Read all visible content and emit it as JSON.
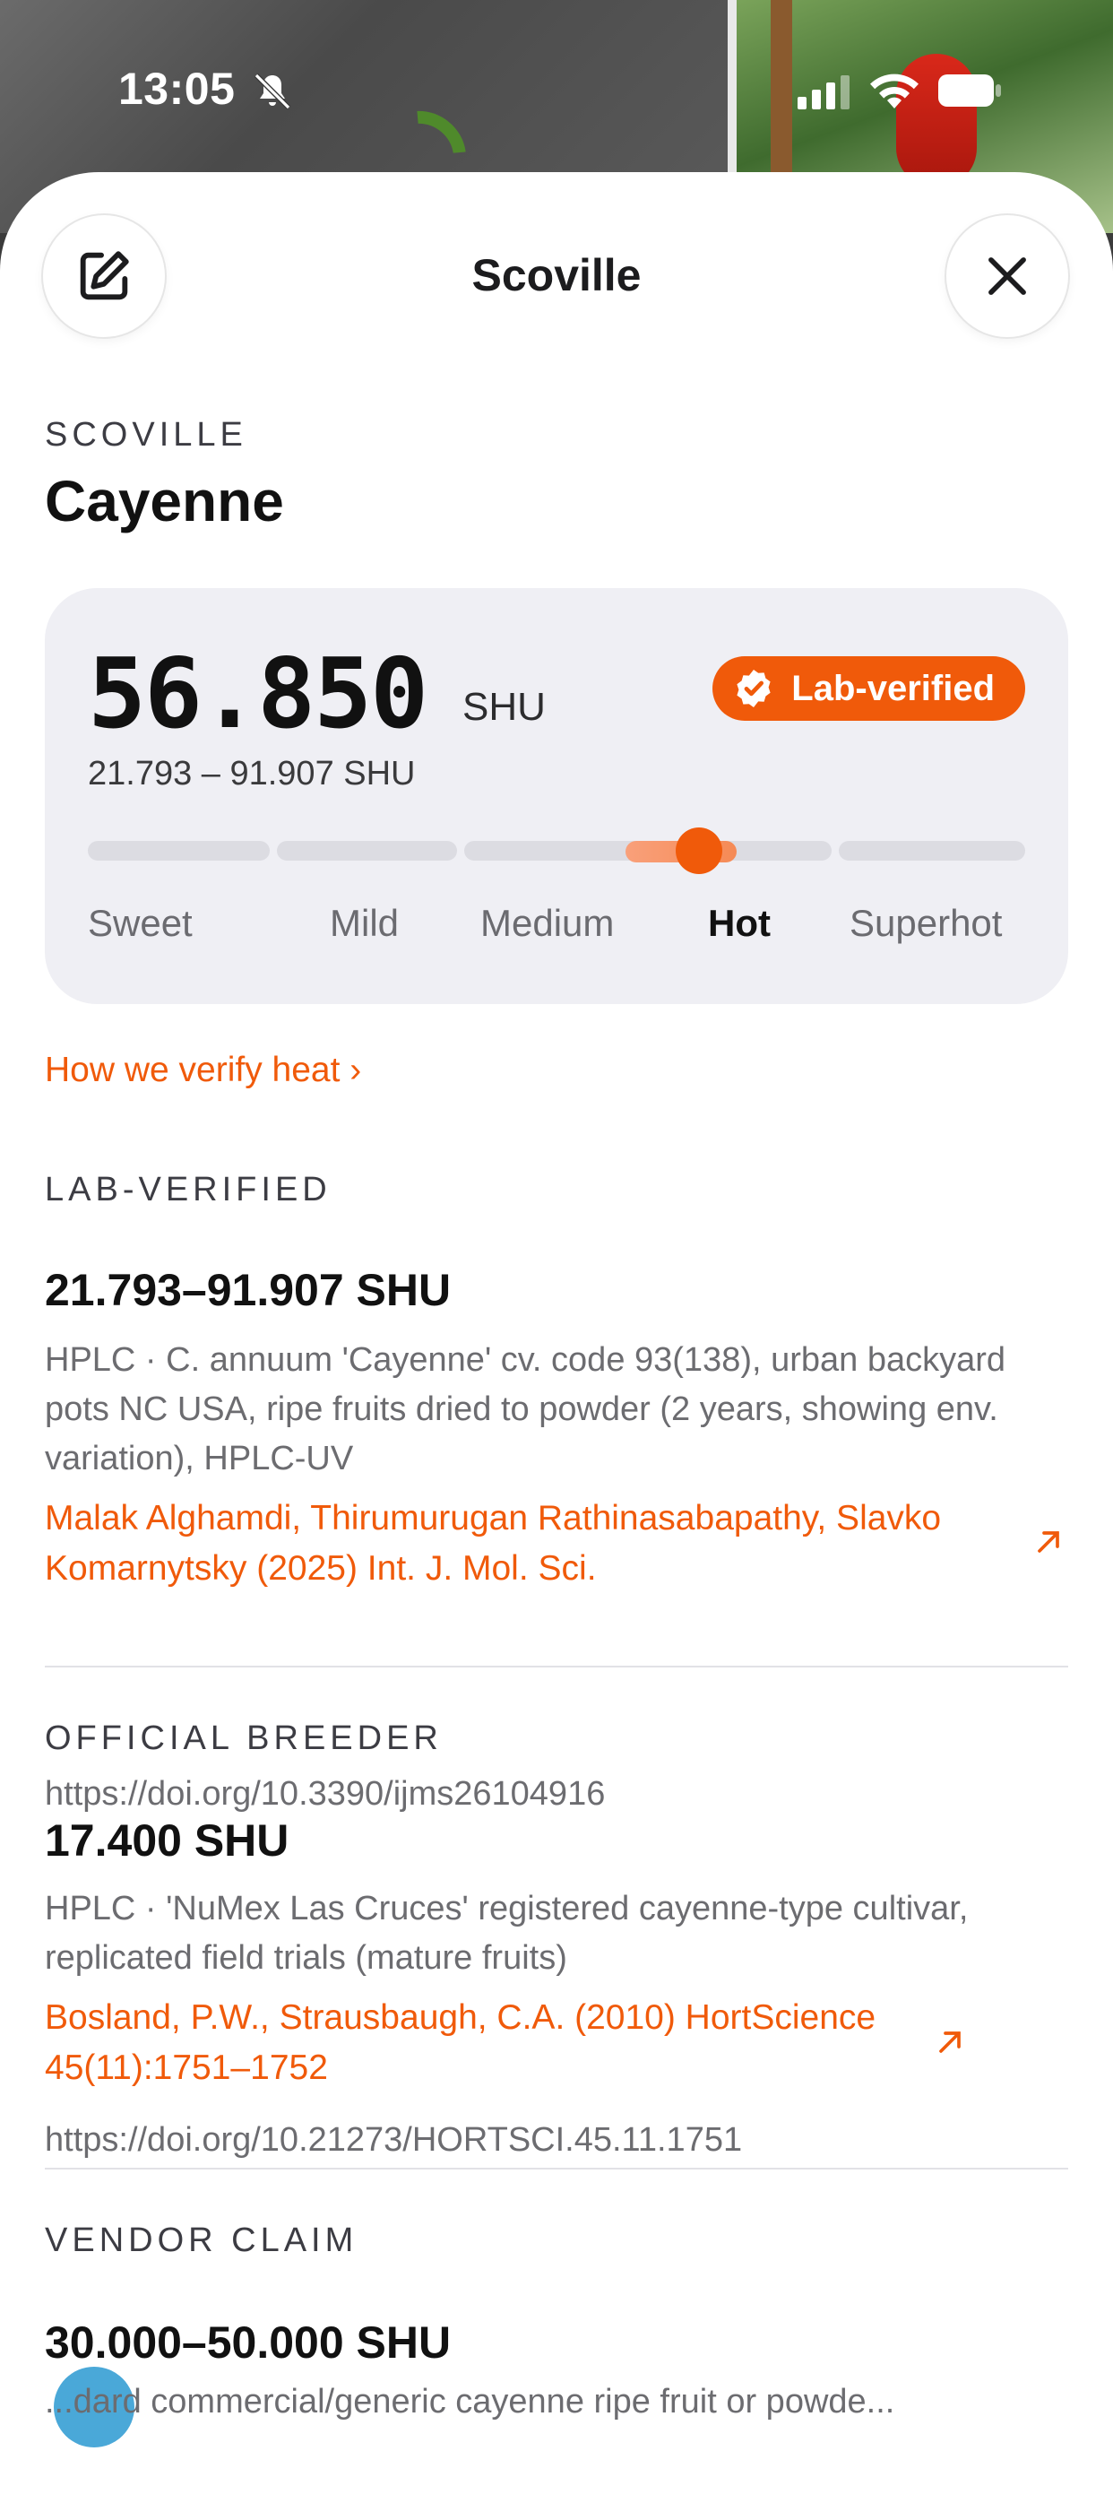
{
  "status": {
    "time": "13:05"
  },
  "header": {
    "title": "Scoville"
  },
  "pepper": {
    "eyebrow": "SCOVILLE",
    "name": "Cayenne"
  },
  "heat": {
    "value": "56.850",
    "unit": "SHU",
    "range": "21.793 – 91.907 SHU",
    "badge": "Lab-verified",
    "levels": [
      "Sweet",
      "Mild",
      "Medium",
      "Hot",
      "Superhot"
    ],
    "active_level": "Hot",
    "scale_position": 0.652
  },
  "verify_link": "How we verify heat ›",
  "sources": [
    {
      "heading": "LAB-VERIFIED",
      "value": "21.793–91.907 SHU",
      "description": "HPLC · C. annuum 'Cayenne' cv. code 93(138), urban backyard pots NC USA, ripe fruits dried to powder (2 years, showing env. variation), HPLC-UV",
      "citation": "Malak Alghamdi, Thirumurugan Rathinasabapathy, Slavko Komarnytsky (2025) Int. J. Mol. Sci.",
      "doi": "https://doi.org/10.3390/ijms26104916"
    },
    {
      "heading": "OFFICIAL BREEDER",
      "value": "17.400 SHU",
      "description": "HPLC · 'NuMex Las Cruces' registered cayenne-type cultivar, replicated field trials (mature fruits)",
      "citation": "Bosland, P.W., Strausbaugh, C.A. (2010) HortScience 45(11):1751–1752",
      "doi": "https://doi.org/10.21273/HORTSCI.45.11.1751"
    },
    {
      "heading": "VENDOR CLAIM",
      "value": "30.000–50.000 SHU",
      "description": "...dard commercial/generic cayenne ripe fruit or powde..."
    }
  ],
  "colors": {
    "accent": "#f05a0a",
    "card": "#efeff4",
    "text": "#111111",
    "muted": "#6c6c70"
  }
}
